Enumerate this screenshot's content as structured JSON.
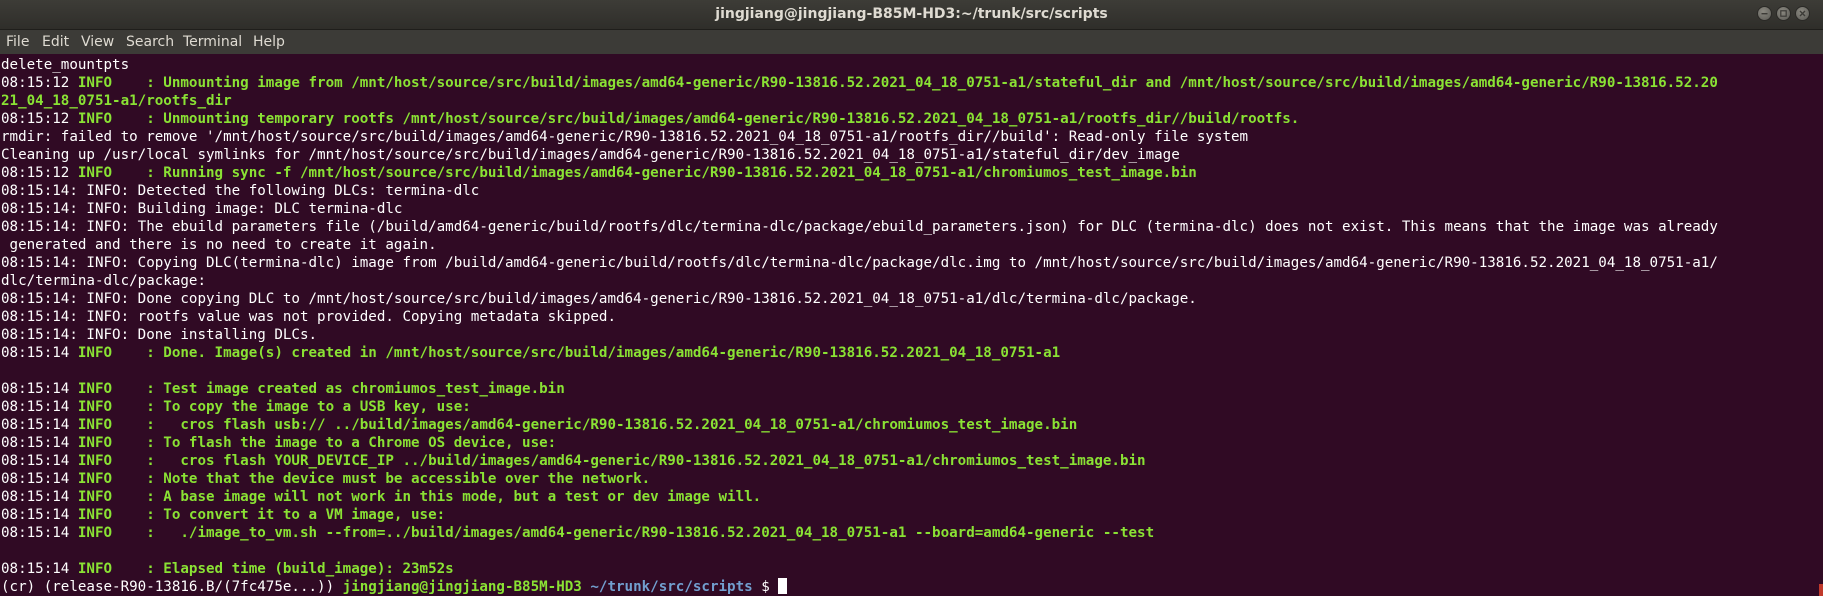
{
  "window": {
    "title": "jingjiang@jingjiang-B85M-HD3:~/trunk/src/scripts"
  },
  "menu": {
    "items": [
      "File",
      "Edit",
      "View",
      "Search",
      "Terminal",
      "Help"
    ]
  },
  "terminal": {
    "lines": [
      {
        "type": "plain",
        "text": "delete_mountpts"
      },
      {
        "type": "info",
        "ts": "08:15:12 ",
        "msg": "INFO    : Unmounting image from /mnt/host/source/src/build/images/amd64-generic/R90-13816.52.2021_04_18_0751-a1/stateful_dir and /mnt/host/source/src/build/images/amd64-generic/R90-13816.52.20"
      },
      {
        "type": "green",
        "text": "21_04_18_0751-a1/rootfs_dir"
      },
      {
        "type": "info",
        "ts": "08:15:12 ",
        "msg": "INFO    : Unmounting temporary rootfs /mnt/host/source/src/build/images/amd64-generic/R90-13816.52.2021_04_18_0751-a1/rootfs_dir//build/rootfs."
      },
      {
        "type": "plain",
        "text": "rmdir: failed to remove '/mnt/host/source/src/build/images/amd64-generic/R90-13816.52.2021_04_18_0751-a1/rootfs_dir//build': Read-only file system"
      },
      {
        "type": "plain",
        "text": "Cleaning up /usr/local symlinks for /mnt/host/source/src/build/images/amd64-generic/R90-13816.52.2021_04_18_0751-a1/stateful_dir/dev_image"
      },
      {
        "type": "info",
        "ts": "08:15:12 ",
        "msg": "INFO    : Running sync -f /mnt/host/source/src/build/images/amd64-generic/R90-13816.52.2021_04_18_0751-a1/chromiumos_test_image.bin"
      },
      {
        "type": "plain",
        "text": "08:15:14: INFO: Detected the following DLCs: termina-dlc"
      },
      {
        "type": "plain",
        "text": "08:15:14: INFO: Building image: DLC termina-dlc"
      },
      {
        "type": "plain",
        "text": "08:15:14: INFO: The ebuild parameters file (/build/amd64-generic/build/rootfs/dlc/termina-dlc/package/ebuild_parameters.json) for DLC (termina-dlc) does not exist. This means that the image was already"
      },
      {
        "type": "plain",
        "text": " generated and there is no need to create it again."
      },
      {
        "type": "plain",
        "text": "08:15:14: INFO: Copying DLC(termina-dlc) image from /build/amd64-generic/build/rootfs/dlc/termina-dlc/package/dlc.img to /mnt/host/source/src/build/images/amd64-generic/R90-13816.52.2021_04_18_0751-a1/"
      },
      {
        "type": "plain",
        "text": "dlc/termina-dlc/package:"
      },
      {
        "type": "plain",
        "text": "08:15:14: INFO: Done copying DLC to /mnt/host/source/src/build/images/amd64-generic/R90-13816.52.2021_04_18_0751-a1/dlc/termina-dlc/package."
      },
      {
        "type": "plain",
        "text": "08:15:14: INFO: rootfs value was not provided. Copying metadata skipped."
      },
      {
        "type": "plain",
        "text": "08:15:14: INFO: Done installing DLCs."
      },
      {
        "type": "info",
        "ts": "08:15:14 ",
        "msg": "INFO    : Done. Image(s) created in /mnt/host/source/src/build/images/amd64-generic/R90-13816.52.2021_04_18_0751-a1"
      },
      {
        "type": "plain",
        "text": ""
      },
      {
        "type": "info",
        "ts": "08:15:14 ",
        "msg": "INFO    : Test image created as chromiumos_test_image.bin"
      },
      {
        "type": "info",
        "ts": "08:15:14 ",
        "msg": "INFO    : To copy the image to a USB key, use:"
      },
      {
        "type": "info",
        "ts": "08:15:14 ",
        "msg": "INFO    :   cros flash usb:// ../build/images/amd64-generic/R90-13816.52.2021_04_18_0751-a1/chromiumos_test_image.bin"
      },
      {
        "type": "info",
        "ts": "08:15:14 ",
        "msg": "INFO    : To flash the image to a Chrome OS device, use:"
      },
      {
        "type": "info",
        "ts": "08:15:14 ",
        "msg": "INFO    :   cros flash YOUR_DEVICE_IP ../build/images/amd64-generic/R90-13816.52.2021_04_18_0751-a1/chromiumos_test_image.bin"
      },
      {
        "type": "info",
        "ts": "08:15:14 ",
        "msg": "INFO    : Note that the device must be accessible over the network."
      },
      {
        "type": "info",
        "ts": "08:15:14 ",
        "msg": "INFO    : A base image will not work in this mode, but a test or dev image will."
      },
      {
        "type": "info",
        "ts": "08:15:14 ",
        "msg": "INFO    : To convert it to a VM image, use:"
      },
      {
        "type": "info",
        "ts": "08:15:14 ",
        "msg": "INFO    :   ./image_to_vm.sh --from=../build/images/amd64-generic/R90-13816.52.2021_04_18_0751-a1 --board=amd64-generic --test"
      },
      {
        "type": "plain",
        "text": ""
      },
      {
        "type": "info",
        "ts": "08:15:14 ",
        "msg": "INFO    : Elapsed time (build_image): 23m52s"
      }
    ],
    "prompt": {
      "env": "(cr) (release-R90-13816.B/(7fc475e...)) ",
      "user_host": "jingjiang@jingjiang-B85M-HD3",
      "path": " ~/trunk/src/scripts",
      "symbol": " $ "
    }
  },
  "colors": {
    "background": "#300a24",
    "green": "#8ae234",
    "blue": "#729fcf",
    "text": "#ffffff"
  },
  "icons": [
    "minimize-icon",
    "maximize-icon",
    "close-icon"
  ]
}
